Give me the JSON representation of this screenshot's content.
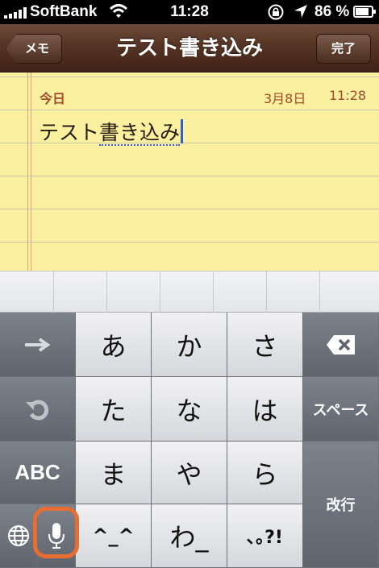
{
  "status_bar": {
    "carrier": "SoftBank",
    "time": "11:28",
    "battery": "86 %",
    "battery_level": 0.86,
    "icons": [
      "signal-icon",
      "wifi-icon",
      "rotation-lock-icon",
      "location-arrow-icon",
      "battery-icon"
    ]
  },
  "nav_bar": {
    "back_label": "メモ",
    "title": "テスト書き込み",
    "done_label": "完了",
    "color": "#553424"
  },
  "note": {
    "date_label": "今日",
    "date": "3月8日",
    "time": "11:28",
    "body_plain": "テスト",
    "body_marked": "書き込み",
    "paper_color": "#faf0a0",
    "header_color": "#a04b2a"
  },
  "keyboard": {
    "kana_row1": [
      "あ",
      "か",
      "さ"
    ],
    "kana_row2": [
      "た",
      "な",
      "は"
    ],
    "kana_row3": [
      "ま",
      "や",
      "ら"
    ],
    "kana_row4": [
      "^_^",
      "わ_",
      "､｡?!"
    ],
    "space_label": "スペース",
    "return_label": "改行",
    "abc_label": "ABC",
    "icons": [
      "arrow-right-icon",
      "undo-icon",
      "globe-icon",
      "microphone-icon",
      "delete-icon"
    ],
    "highlight_color": "#e86d33"
  }
}
